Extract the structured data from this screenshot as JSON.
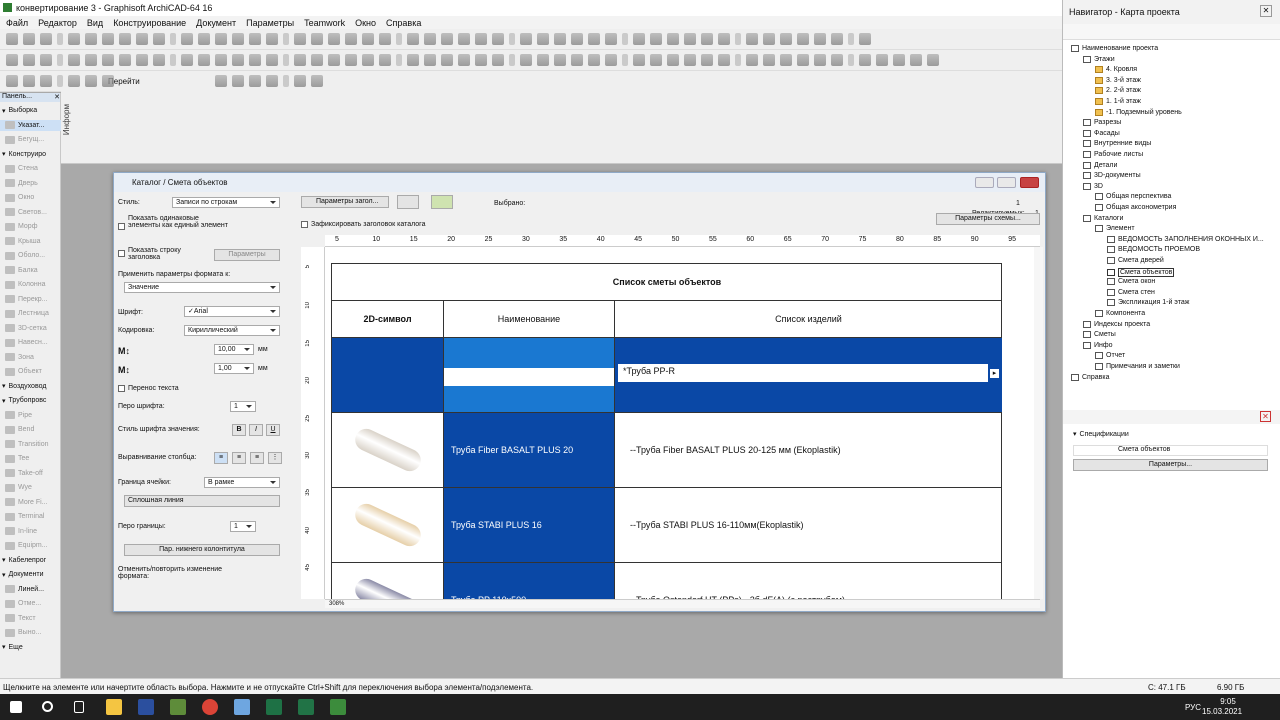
{
  "app": {
    "title": "конвертирование 3 - Graphisoft ArchiCAD-64 16"
  },
  "menu": [
    "Файл",
    "Редактор",
    "Вид",
    "Конструирование",
    "Документ",
    "Параметры",
    "Teamwork",
    "Окно",
    "Справка"
  ],
  "toolbar3": {
    "goto": "Перейти"
  },
  "infobox": {
    "label": "Информ"
  },
  "toolbox": {
    "header": "Панель...",
    "items": [
      {
        "label": "Выборка",
        "state": "head"
      },
      {
        "label": "Указат...",
        "state": "act"
      },
      {
        "label": "Бегущ...",
        "state": "dim"
      },
      {
        "label": "Конструиро",
        "state": "head"
      },
      {
        "label": "Стена",
        "state": "dim"
      },
      {
        "label": "Дверь",
        "state": "dim"
      },
      {
        "label": "Окно",
        "state": "dim"
      },
      {
        "label": "Светов...",
        "state": "dim"
      },
      {
        "label": "Морф",
        "state": "dim"
      },
      {
        "label": "Крыша",
        "state": "dim"
      },
      {
        "label": "Оболо...",
        "state": "dim"
      },
      {
        "label": "Балка",
        "state": "dim"
      },
      {
        "label": "Колонна",
        "state": "dim"
      },
      {
        "label": "Перекр...",
        "state": "dim"
      },
      {
        "label": "Лестница",
        "state": "dim"
      },
      {
        "label": "3D-сетка",
        "state": "dim"
      },
      {
        "label": "Навесн...",
        "state": "dim"
      },
      {
        "label": "Зона",
        "state": "dim"
      },
      {
        "label": "Объект",
        "state": "dim"
      },
      {
        "label": "Воздуховод",
        "state": "head"
      },
      {
        "label": "Трубопровс",
        "state": "head"
      },
      {
        "label": "Pipe",
        "state": "dim"
      },
      {
        "label": "Bend",
        "state": "dim"
      },
      {
        "label": "Transition",
        "state": "dim"
      },
      {
        "label": "Tee",
        "state": "dim"
      },
      {
        "label": "Take-off",
        "state": "dim"
      },
      {
        "label": "Wye",
        "state": "dim"
      },
      {
        "label": "More Fi...",
        "state": "dim"
      },
      {
        "label": "Terminal",
        "state": "dim"
      },
      {
        "label": "In-line",
        "state": "dim"
      },
      {
        "label": "Equipm...",
        "state": "dim"
      },
      {
        "label": "Кабелепрог",
        "state": "head"
      },
      {
        "label": "Документи",
        "state": "head"
      },
      {
        "label": "Линей...",
        "state": "act"
      },
      {
        "label": "Отме...",
        "state": "dim"
      },
      {
        "label": "Текст",
        "state": "dim"
      },
      {
        "label": "Выно...",
        "state": "dim"
      },
      {
        "label": "Еще",
        "state": "head"
      }
    ]
  },
  "catalog": {
    "title": "Каталог / Смета объектов",
    "style_label": "Стиль:",
    "style_value": "Записи по строкам",
    "show_same": "Показать одинаковые элементы как единый элемент",
    "show_header": "Показать строку заголовка",
    "params_btn": "Параметры",
    "apply_label": "Применить параметры формата к:",
    "apply_value": "Значение",
    "font_label": "Шрифт:",
    "font_value": "✓Arial",
    "enc_label": "Кодировка:",
    "enc_value": "Кириллический",
    "size1": "10,00",
    "size2": "1,00",
    "unit": "мм",
    "wrap": "Перенос текста",
    "pen_font": "Перо шрифта:",
    "pen_val": "1",
    "value_style": "Стиль шрифта значения:",
    "b": "B",
    "i": "I",
    "u": "U",
    "align": "Выравнивание столбца:",
    "border_label": "Граница ячейки:",
    "border_value": "В рамке",
    "line": "Сплошная линия",
    "pen_border": "Перо границы:",
    "footer_btn": "Пар. нижнего колонтитула",
    "undo": "Отменить/повторить изменение формата:",
    "header_params": "Параметры загол...",
    "fix_header": "Зафиксировать заголовок каталога",
    "selected": "Выбрано:",
    "selected_val": "1",
    "editable": "Редактируемых:",
    "editable_val": "1",
    "scheme_btn": "Параметры схемы...",
    "zoom": "308%",
    "ruler": [
      "5",
      "10",
      "15",
      "20",
      "25",
      "30",
      "35",
      "40",
      "45",
      "50",
      "55",
      "60",
      "65",
      "70",
      "75",
      "80",
      "85",
      "90",
      "95"
    ],
    "vruler": [
      "5",
      "10",
      "15",
      "20",
      "25",
      "30",
      "35",
      "40",
      "45"
    ],
    "table": {
      "title": "Список сметы объектов",
      "headers": [
        "2D-символ",
        "Наименование",
        "Список изделий"
      ],
      "edit_value": "*Труба PP-R",
      "rows": [
        {
          "name": "Труба Fiber BASALT PLUS 20",
          "desc": "--Труба Fiber BASALT PLUS 20-125 мм (Ekoplastik)",
          "color": "#d9d2c8"
        },
        {
          "name": "Труба STABI PLUS 16",
          "desc": "--Труба STABI PLUS 16-110мм(Ekoplastik)",
          "color": "#e6cfa8"
        },
        {
          "name": "Труба PP 110х500",
          "desc": "--Труба Ostendorf HT (PPs) - 2б dF(A) (с раструбом)",
          "color": "#8a8aa6"
        }
      ]
    }
  },
  "navigator": {
    "title": "Навигатор - Карта проекта",
    "tree": [
      {
        "label": "Наименование проекта",
        "level": 0
      },
      {
        "label": "Этажи",
        "level": 1
      },
      {
        "label": "4. Кровля",
        "level": 2
      },
      {
        "label": "3. 3-й этаж",
        "level": 2
      },
      {
        "label": "2. 2-й этаж",
        "level": 2
      },
      {
        "label": "1. 1-й этаж",
        "level": 2
      },
      {
        "label": "-1. Подземный уровень",
        "level": 2
      },
      {
        "label": "Разрезы",
        "level": 1
      },
      {
        "label": "Фасады",
        "level": 1
      },
      {
        "label": "Внутренние виды",
        "level": 1
      },
      {
        "label": "Рабочие листы",
        "level": 1
      },
      {
        "label": "Детали",
        "level": 1
      },
      {
        "label": "3D-документы",
        "level": 1
      },
      {
        "label": "3D",
        "level": 1
      },
      {
        "label": "Общая перспектива",
        "level": 2
      },
      {
        "label": "Общая аксонометрия",
        "level": 2
      },
      {
        "label": "Каталоги",
        "level": 1
      },
      {
        "label": "Элемент",
        "level": 2
      },
      {
        "label": "ВЕДОМОСТЬ ЗАПОЛНЕНИЯ ОКОННЫХ И...",
        "level": 3
      },
      {
        "label": "ВЕДОМОСТЬ ПРОЕМОВ",
        "level": 3
      },
      {
        "label": "Смета дверей",
        "level": 3
      },
      {
        "label": "Смета объектов",
        "level": 3,
        "hl": true
      },
      {
        "label": "Смета окон",
        "level": 3
      },
      {
        "label": "Смета стен",
        "level": 3
      },
      {
        "label": "Экспликация 1-й этаж",
        "level": 3
      },
      {
        "label": "Компонента",
        "level": 2
      },
      {
        "label": "Индексы проекта",
        "level": 1
      },
      {
        "label": "Сметы",
        "level": 1
      },
      {
        "label": "Инфо",
        "level": 1
      },
      {
        "label": "Отчет",
        "level": 2
      },
      {
        "label": "Примечания и заметки",
        "level": 2
      },
      {
        "label": "Справка",
        "level": 0
      }
    ],
    "spec_label": "Спецификации",
    "spec_item": "Смета объектов",
    "spec_btn": "Параметры..."
  },
  "status": {
    "text": "Щелкните на элементе или начертите область выбора. Нажмите и не отпускайте Ctrl+Shift для переключения выбора элемента/подэлемента.",
    "disk_c": "С: 47.1 ГБ",
    "disk2": "6.90 ГБ"
  },
  "taskbar": {
    "lang": "РУС",
    "time": "9:05",
    "date": "15.03.2021"
  }
}
